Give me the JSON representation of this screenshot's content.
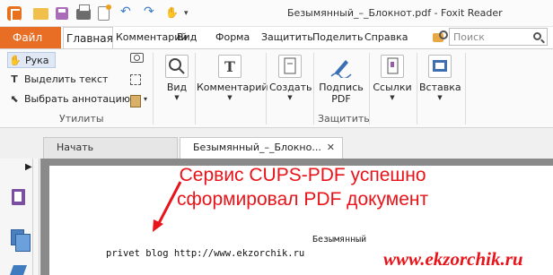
{
  "window": {
    "title": "Безымянный_–_Блокнот.pdf - Foxit Reader"
  },
  "ribbon_tabs": {
    "file": "Файл",
    "home": "Главная",
    "comment": "Комментарий",
    "view": "Вид",
    "form": "Форма",
    "protect": "Защитить",
    "share": "Поделить",
    "help": "Справка"
  },
  "search": {
    "placeholder": "Поиск"
  },
  "ribbon": {
    "tools": {
      "hand": "Рука",
      "select_text": "Выделить текст",
      "select_annotation": "Выбрать аннотацию"
    },
    "group_utilities": "Утилиты",
    "view_btn": "Вид",
    "comment_btn": "Комментарий",
    "create_btn": "Создать",
    "sign_btn_line1": "Подпись",
    "sign_btn_line2": "PDF",
    "group_protect": "Защитить",
    "links_btn": "Ссылки",
    "insert_btn": "Вставка"
  },
  "doc_tabs": {
    "start": "Начать",
    "document": "Безымянный_–_Блокно..."
  },
  "document": {
    "header_text": "Безымянный",
    "body_text": "privet blog http://www.ekzorchik.ru"
  },
  "annotation": {
    "line1": "Сервис CUPS-PDF успешно",
    "line2": "сформировал PDF документ",
    "color": "#e8141a"
  },
  "watermark": "www.ekzorchik.ru",
  "colors": {
    "file_tab": "#e86e26",
    "annotation_red": "#e8141a"
  }
}
